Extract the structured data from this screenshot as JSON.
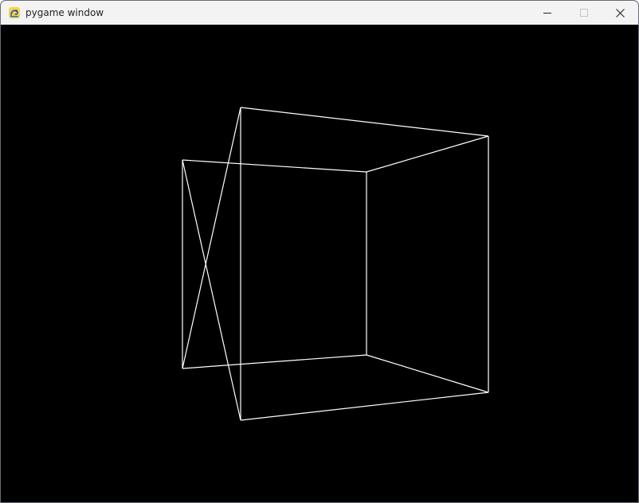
{
  "window": {
    "title": "pygame window",
    "icon": "pygame-snake-icon",
    "controls": {
      "minimize": "minimize-icon",
      "maximize": "maximize-icon",
      "close": "close-icon"
    }
  },
  "scene": {
    "background_color": "#000000",
    "line_color": "#ffffff",
    "shape": "wireframe-cube"
  }
}
